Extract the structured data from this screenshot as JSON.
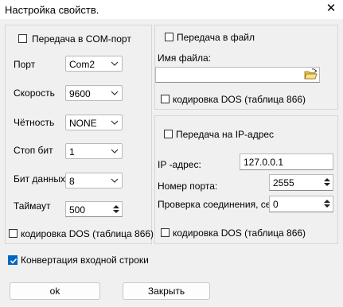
{
  "window": {
    "title": "Настройка свойств."
  },
  "com": {
    "enable_label": "Передача в COM-порт",
    "port_label": "Порт",
    "port_value": "Com2",
    "speed_label": "Скорость",
    "speed_value": "9600",
    "parity_label": "Чётность",
    "parity_value": "NONE",
    "stopbits_label": "Стоп бит",
    "stopbits_value": "1",
    "databits_label": "Бит данных",
    "databits_value": "8",
    "timeout_label": "Таймаут",
    "timeout_value": "500",
    "dos_label": "кодировка DOS (таблица 866)"
  },
  "file": {
    "enable_label": "Передача в файл",
    "filename_label": "Имя файла:",
    "filename_value": "",
    "dos_label": "кодировка DOS (таблица 866)"
  },
  "ip": {
    "enable_label": "Передача на IP-адрес",
    "address_label": "IP -адрес:",
    "address_value": "127.0.0.1",
    "port_label": "Номер порта:",
    "port_value": "2555",
    "check_label": "Проверка соединения, сек",
    "check_value": "0",
    "dos_label": "кодировка DOS (таблица 866)"
  },
  "convert_label": "Конвертация входной строки",
  "convert_checked": true,
  "buttons": {
    "ok": "ok",
    "close": "Закрыть"
  }
}
